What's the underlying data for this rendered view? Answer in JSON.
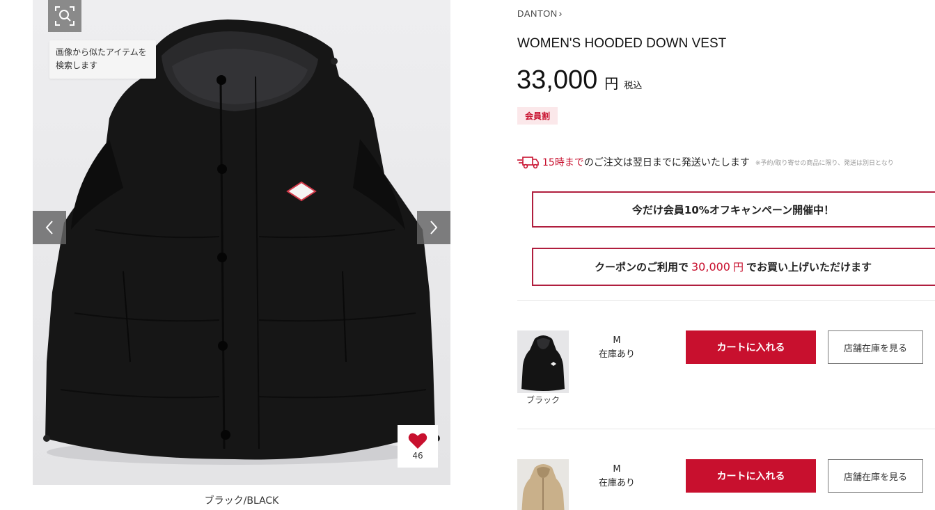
{
  "gallery": {
    "visual_search_tooltip": "画像から似たアイテムを検索します",
    "favorite_count": "46",
    "color_caption": "ブラック/BLACK"
  },
  "product": {
    "brand": "DANTON",
    "name": "WOMEN'S HOODED DOWN VEST",
    "price": "33,000",
    "currency": "円",
    "tax_label": "税込",
    "member_badge": "会員割"
  },
  "shipping": {
    "highlight": "15時まで",
    "text": "のご注文は翌日までに発送いたします",
    "note": "※予約/取り寄せの商品に限り、発送は別日となり"
  },
  "campaign": {
    "text": "今だけ会員10%オフキャンペーン開催中！",
    "coupon_prefix": "クーポンのご利用で",
    "coupon_price": "30,000",
    "coupon_currency": "円",
    "coupon_suffix": "でお買い上げいただけます"
  },
  "skus": [
    {
      "color": "ブラック",
      "size": "M",
      "stock": "在庫あり",
      "cart_label": "カートに入れる",
      "store_label": "店舗在庫を見る"
    },
    {
      "size": "M",
      "stock": "在庫あり",
      "cart_label": "カートに入れる",
      "store_label": "店舗在庫を見る"
    }
  ],
  "colors": {
    "accent": "#c8102e",
    "border_accent": "#b01e3e",
    "badge_bg": "#fbe8ea"
  },
  "icons": [
    "visual-search-icon",
    "chevron-left-icon",
    "chevron-right-icon",
    "heart-icon",
    "truck-icon",
    "chevron-right-small-icon"
  ]
}
